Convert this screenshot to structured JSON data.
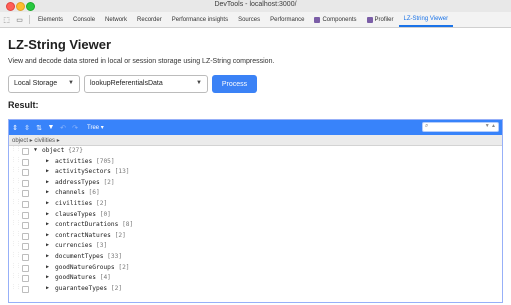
{
  "window": {
    "title": "DevTools - localhost:3000/"
  },
  "devtools": {
    "tabs": [
      {
        "label": "Elements"
      },
      {
        "label": "Console"
      },
      {
        "label": "Network"
      },
      {
        "label": "Recorder"
      },
      {
        "label": "Performance insights"
      },
      {
        "label": "Sources"
      },
      {
        "label": "Performance"
      },
      {
        "label": "Components"
      },
      {
        "label": "Profiler"
      },
      {
        "label": "LZ-String Viewer",
        "active": true
      }
    ]
  },
  "page": {
    "title": "LZ-String Viewer",
    "description": "View and decode data stored in local or session storage using LZ-String compression.",
    "storage_select": "Local Storage",
    "key_select": "lookupReferentialsData",
    "process_button": "Process",
    "result_label": "Result:"
  },
  "viewer": {
    "mode_label": "Tree ▾",
    "breadcrumb": "object ▸ civilities ▸",
    "root": {
      "label": "object",
      "count": "{27}"
    },
    "items": [
      {
        "key": "activities",
        "count": "[705]"
      },
      {
        "key": "activitySectors",
        "count": "[13]"
      },
      {
        "key": "addressTypes",
        "count": "[2]"
      },
      {
        "key": "channels",
        "count": "[6]"
      },
      {
        "key": "civilities",
        "count": "[2]"
      },
      {
        "key": "clauseTypes",
        "count": "[0]"
      },
      {
        "key": "contractDurations",
        "count": "[8]"
      },
      {
        "key": "contractNatures",
        "count": "[2]"
      },
      {
        "key": "currencies",
        "count": "[3]"
      },
      {
        "key": "documentTypes",
        "count": "[33]"
      },
      {
        "key": "goodNatureGroups",
        "count": "[2]"
      },
      {
        "key": "goodNatures",
        "count": "[4]"
      },
      {
        "key": "guaranteeTypes",
        "count": "[2]"
      }
    ]
  },
  "colors": {
    "accent": "#3b82f6",
    "toolbar": "#3883fa"
  }
}
